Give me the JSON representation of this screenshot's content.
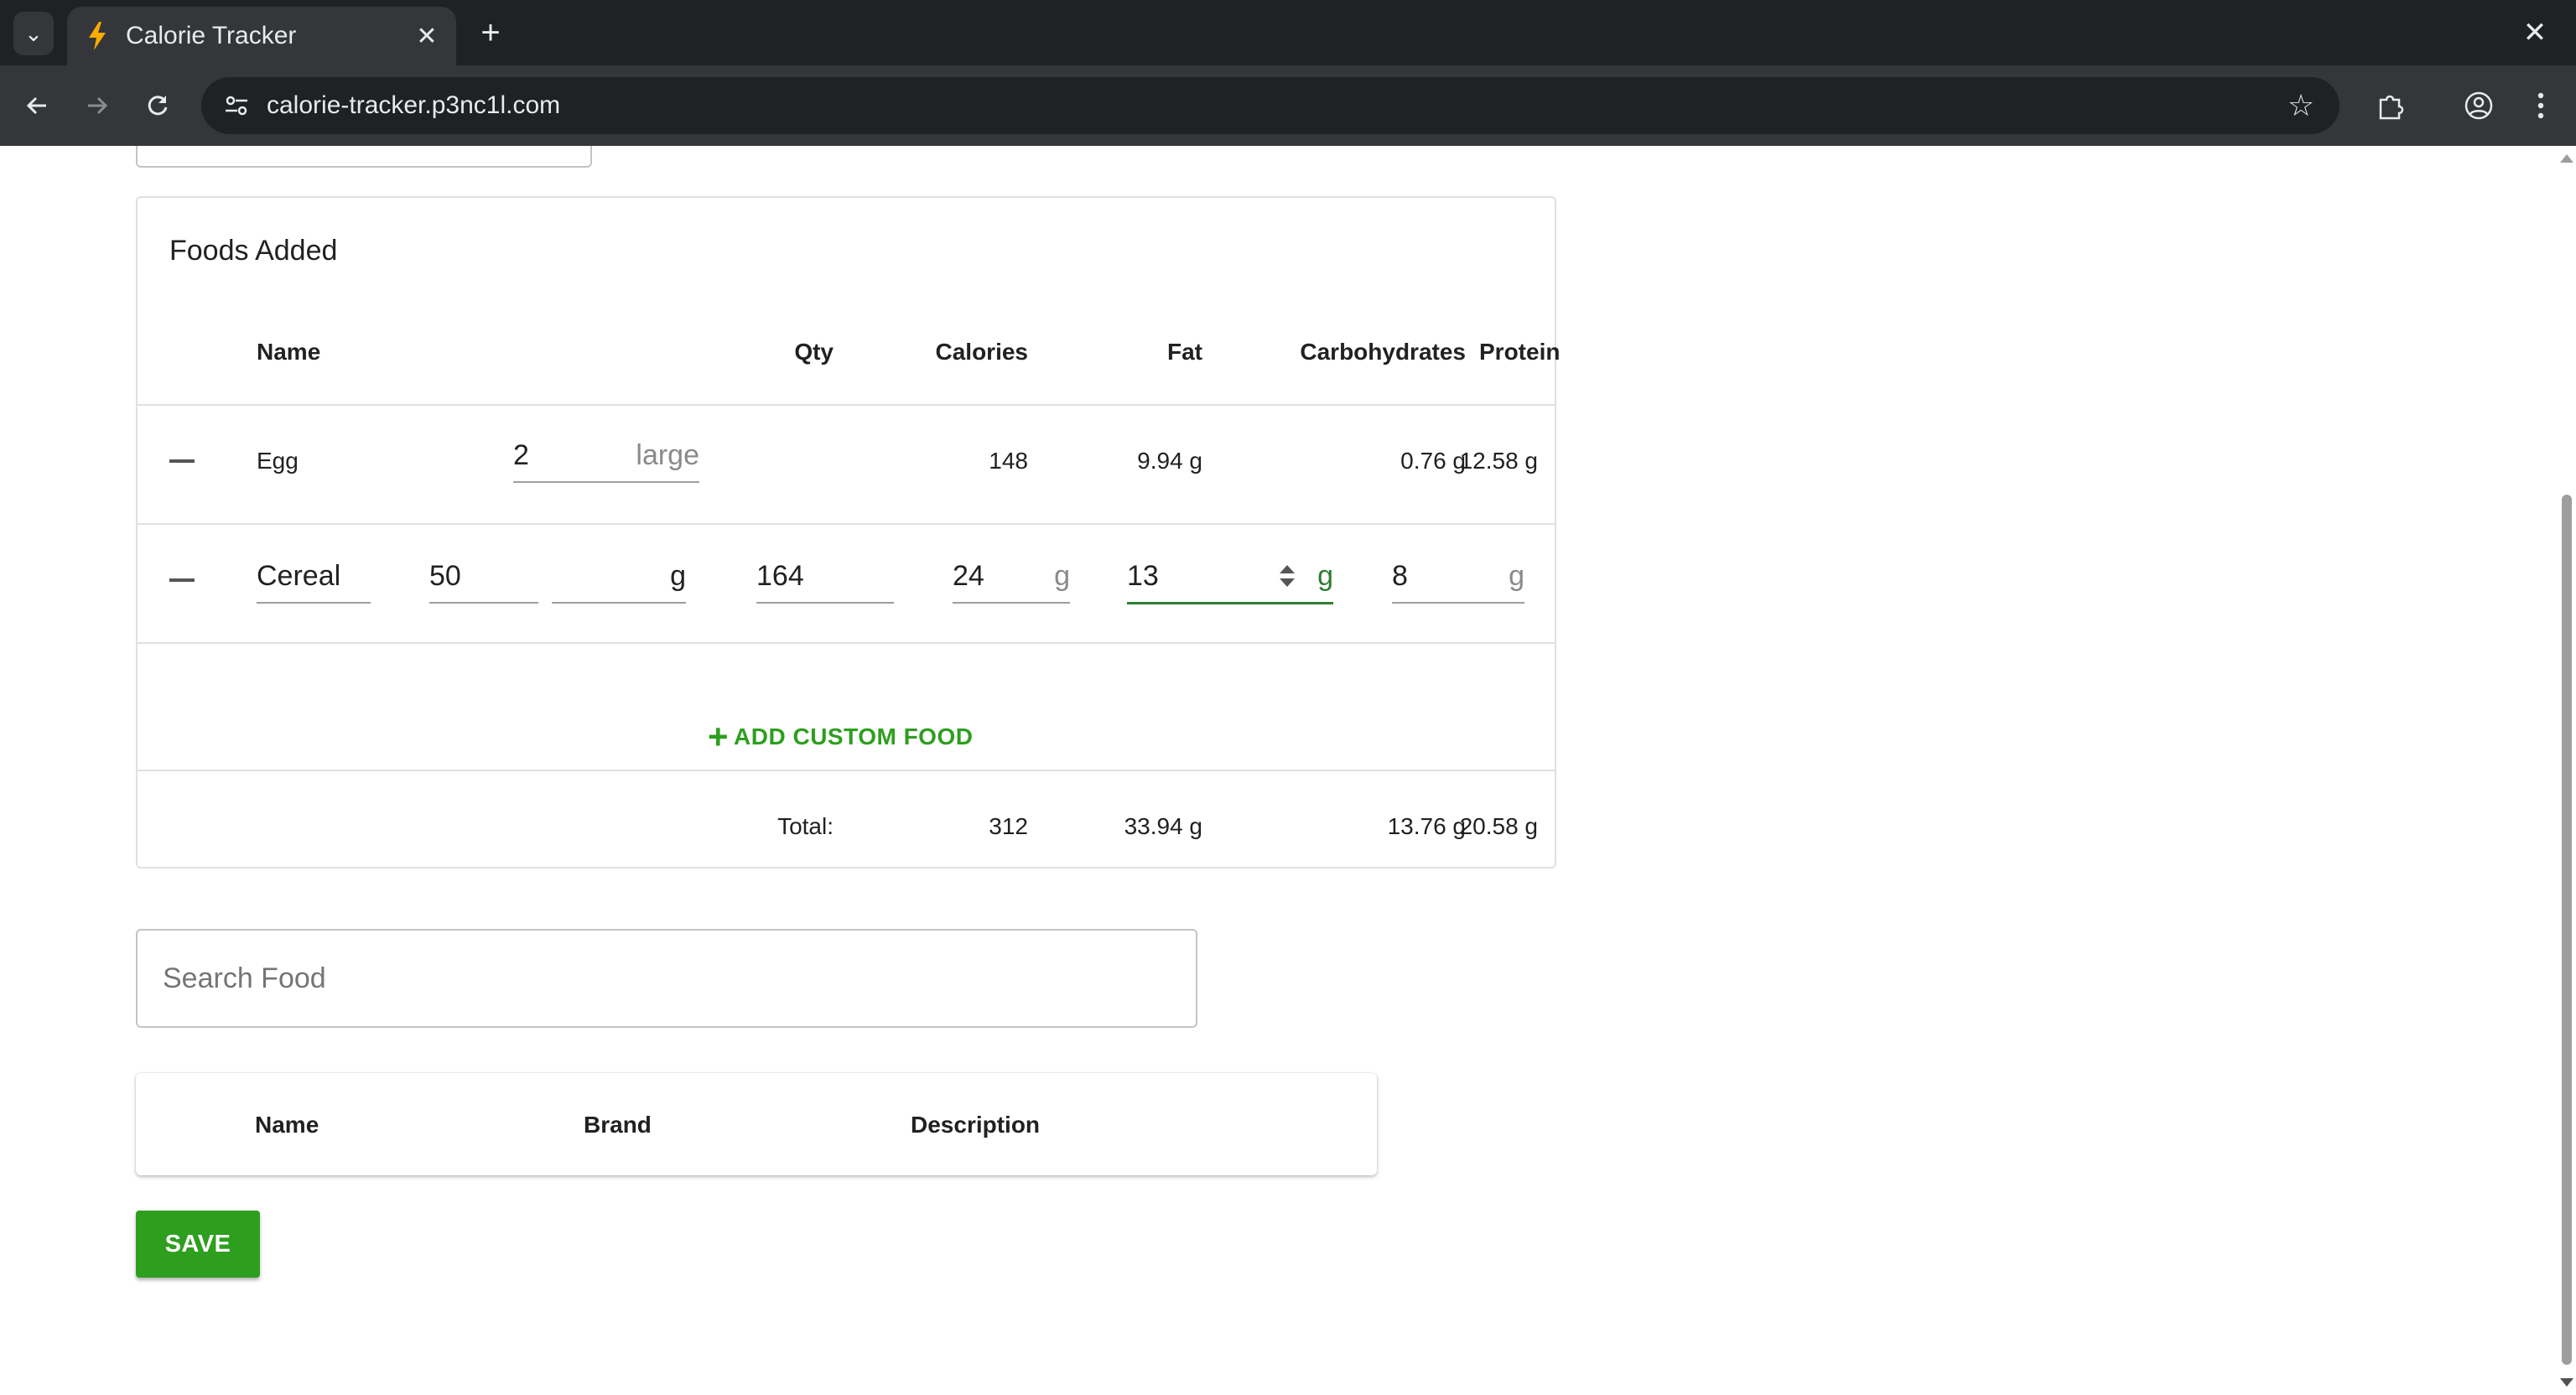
{
  "browser": {
    "tab_title": "Calorie Tracker",
    "url": "calorie-tracker.p3nc1l.com",
    "icons": {
      "tab_menu": "chevron-down-icon",
      "favicon": "lightning-icon",
      "tab_close": "close-icon",
      "new_tab": "plus-icon",
      "window_close": "close-icon",
      "back": "arrow-left-icon",
      "forward": "arrow-right-icon",
      "reload": "reload-icon",
      "site_info": "tune-icon",
      "bookmark": "star-icon",
      "extensions": "puzzle-icon",
      "profile": "account-icon",
      "menu": "kebab-menu-icon"
    }
  },
  "foods_added": {
    "title": "Foods Added",
    "headers": {
      "name": "Name",
      "qty": "Qty",
      "calories": "Calories",
      "fat": "Fat",
      "carbohydrates": "Carbohydrates",
      "protein": "Protein"
    },
    "rows": [
      {
        "name": "Egg",
        "qty": "2",
        "qty_unit": "large",
        "calories": "148",
        "fat": "9.94 g",
        "carbohydrates": "0.76 g",
        "protein": "12.58 g"
      },
      {
        "name": "Cereal",
        "qty": "50",
        "qty_unit": "g",
        "calories": "164",
        "fat": "24",
        "fat_unit": "g",
        "carbohydrates": "13",
        "carbohydrates_unit": "g",
        "protein": "8",
        "protein_unit": "g"
      }
    ],
    "add_custom_label": "ADD CUSTOM FOOD",
    "total": {
      "label": "Total:",
      "calories": "312",
      "fat": "33.94 g",
      "carbohydrates": "13.76 g",
      "protein": "20.58 g"
    }
  },
  "search": {
    "placeholder": "Search Food",
    "value": ""
  },
  "results": {
    "headers": {
      "name": "Name",
      "brand": "Brand",
      "description": "Description"
    }
  },
  "save_label": "SAVE",
  "colors": {
    "accent_green": "#2e9e1f",
    "focus_green": "#2e7d32",
    "chrome_dark": "#202124",
    "chrome_toolbar": "#35363a"
  }
}
